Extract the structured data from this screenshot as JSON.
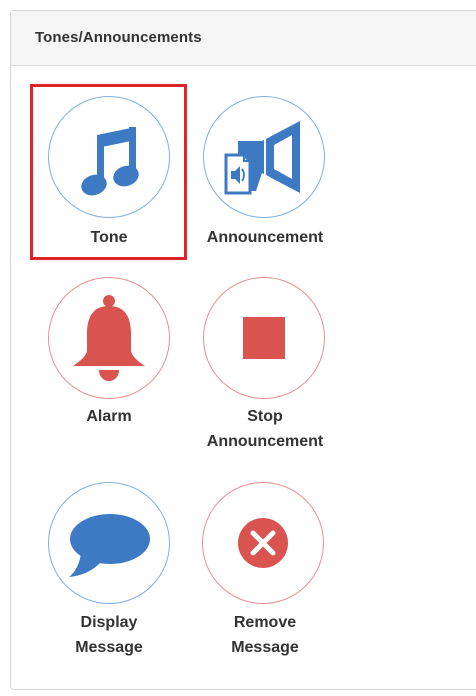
{
  "panel": {
    "title": "Tones/Announcements"
  },
  "tiles": [
    {
      "label": "Tone",
      "icon": "music-note-icon",
      "style": "blue",
      "selected": true
    },
    {
      "label": "Announcement",
      "icon": "megaphone-icon",
      "style": "blue",
      "selected": false
    },
    {
      "label": "Alarm",
      "icon": "bell-icon",
      "style": "red",
      "selected": false
    },
    {
      "label_line1": "Stop",
      "label_line2": "Announcement",
      "icon": "stop-icon",
      "style": "red",
      "selected": false
    },
    {
      "label_line1": "Display",
      "label_line2": "Message",
      "icon": "speech-bubble-icon",
      "style": "blue",
      "selected": false
    },
    {
      "label_line1": "Remove",
      "label_line2": "Message",
      "icon": "remove-x-icon",
      "style": "red",
      "selected": false
    }
  ],
  "colors": {
    "blue_icon": "#3d7ac3",
    "red_icon": "#d9534f",
    "highlight": "#e0232b"
  }
}
